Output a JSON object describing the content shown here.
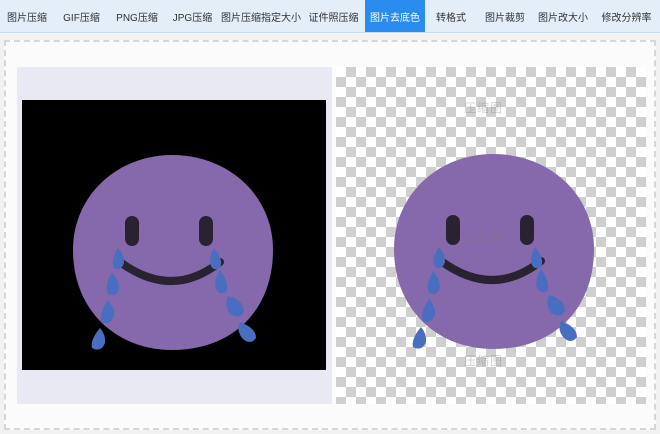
{
  "tabs": [
    {
      "label": "图片压缩",
      "active": false
    },
    {
      "label": "GIF压缩",
      "active": false
    },
    {
      "label": "PNG压缩",
      "active": false
    },
    {
      "label": "JPG压缩",
      "active": false
    },
    {
      "label": "图片压缩指定大小",
      "active": false
    },
    {
      "label": "证件照压缩",
      "active": false
    },
    {
      "label": "图片去底色",
      "active": true
    },
    {
      "label": "转格式",
      "active": false
    },
    {
      "label": "图片裁剪",
      "active": false
    },
    {
      "label": "图片改大小",
      "active": false
    },
    {
      "label": "修改分辨率",
      "active": false
    }
  ],
  "watermark": "压缩图",
  "colors": {
    "accent": "#2b8cf0",
    "emoji_face": "#8668ad",
    "tears": "#4a6ebf",
    "features": "#2a2230"
  },
  "icons": {
    "original": "crying-smiley-emoji",
    "result": "crying-smiley-emoji"
  }
}
